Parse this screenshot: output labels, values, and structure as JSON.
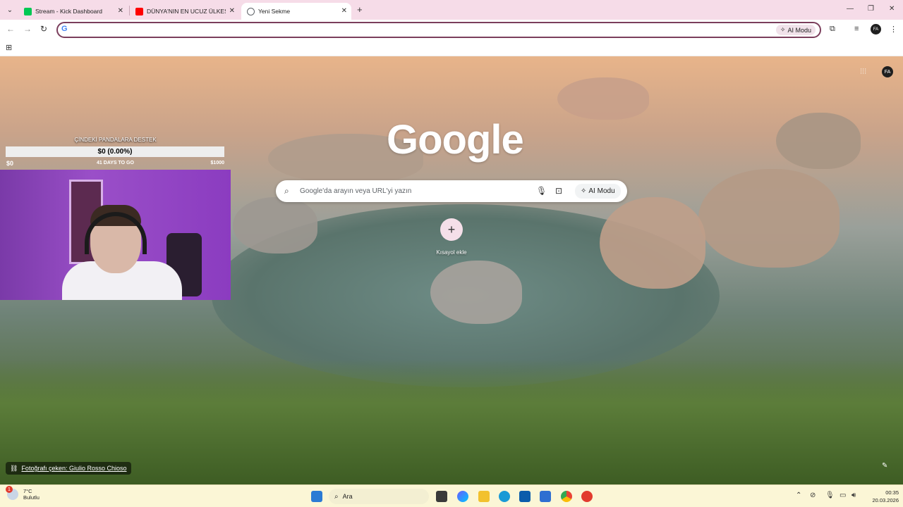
{
  "browser": {
    "tabs": [
      {
        "title": "Stream - Kick Dashboard",
        "favicon_color": "#00c853",
        "active": false
      },
      {
        "title": "DÜNYA'NIN EN UCUZ ÜLKESİ V",
        "favicon_color": "#ff0000",
        "active": false
      },
      {
        "title": "Yeni Sekme",
        "favicon_color": "#5f6368",
        "active": true
      }
    ],
    "omnibox": {
      "value": "",
      "ai_label": "AI Modu"
    },
    "avatar_initials": "FA"
  },
  "ntp": {
    "logo": "Google",
    "search_placeholder": "Google'da arayın veya URL'yi yazın",
    "ai_label": "AI Modu",
    "shortcut_add_label": "Kısayol ekle",
    "photo_credit": "Fotoğrafı çeken: Giulio Rosso Chioso",
    "avatar_initials": "FA"
  },
  "overlay": {
    "donation_title": "ÇİNDEKİ PANDALARA DESTEK",
    "donation_progress": "$0 (0.00%)",
    "donation_progress_fraction": 0.0,
    "donation_min": "$0",
    "donation_days": "41 DAYS TO GO",
    "donation_max": "$1000"
  },
  "taskbar": {
    "weather_temp": "7°C",
    "weather_desc": "Bulutlu",
    "weather_badge": "1",
    "search_label": "Ara",
    "time": "00:35",
    "date": "20.03.2026"
  },
  "colors": {
    "tabstrip": "#f6dce8",
    "omnibox_border": "#7b3e5c",
    "taskbar": "#fbf6d6"
  }
}
